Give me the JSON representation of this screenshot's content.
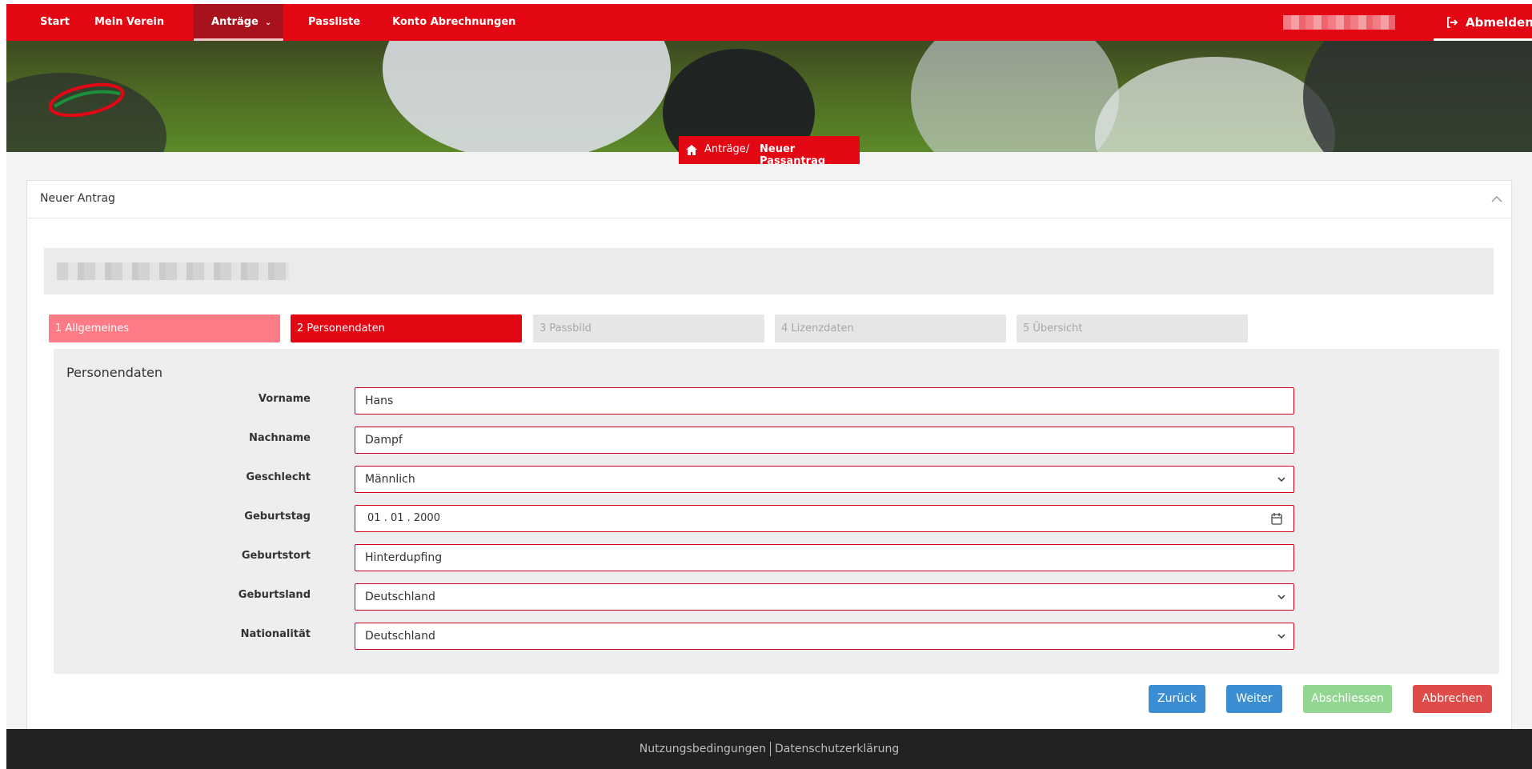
{
  "nav": {
    "items": [
      {
        "label": "Start"
      },
      {
        "label": "Mein Verein"
      },
      {
        "label": "Anträge"
      },
      {
        "label": "Passliste"
      },
      {
        "label": "Konto Abrechnungen"
      }
    ],
    "logout_label": "Abmelden"
  },
  "breadcrumb": {
    "parent": "Anträge",
    "separator": "/",
    "current": "Neuer Passantrag"
  },
  "card": {
    "title": "Neuer Antrag"
  },
  "steps": [
    {
      "label": "1 Allgemeines",
      "state": "done"
    },
    {
      "label": "2 Personendaten",
      "state": "current"
    },
    {
      "label": "3 Passbild",
      "state": "todo"
    },
    {
      "label": "4 Lizenzdaten",
      "state": "todo"
    },
    {
      "label": "5 Übersicht",
      "state": "todo"
    }
  ],
  "form": {
    "title": "Personendaten",
    "fields": [
      {
        "label": "Vorname",
        "value": "Hans",
        "type": "text"
      },
      {
        "label": "Nachname",
        "value": "Dampf",
        "type": "text"
      },
      {
        "label": "Geschlecht",
        "value": "Männlich",
        "type": "select"
      },
      {
        "label": "Geburtstag",
        "value": "01 . 01 . 2000",
        "type": "date"
      },
      {
        "label": "Geburtstort",
        "value": "Hinterdupfing",
        "type": "text"
      },
      {
        "label": "Geburtsland",
        "value": "Deutschland",
        "type": "select"
      },
      {
        "label": "Nationalität",
        "value": "Deutschland",
        "type": "select"
      }
    ]
  },
  "buttons": {
    "back": "Zurück",
    "next": "Weiter",
    "finish": "Abschliessen",
    "cancel": "Abbrechen"
  },
  "footer": {
    "terms": "Nutzungsbedingungen",
    "privacy": "Datenschutzerklärung"
  },
  "colors": {
    "brand_red": "#e30613",
    "step_done": "#fd7b86",
    "button_blue": "#3b8ed1",
    "button_green": "#92d692",
    "button_red": "#de4b48",
    "footer_bg": "#222222"
  },
  "icons": [
    "logout-icon",
    "home-icon",
    "chevron-down-icon",
    "chevron-up-icon",
    "calendar-icon"
  ]
}
